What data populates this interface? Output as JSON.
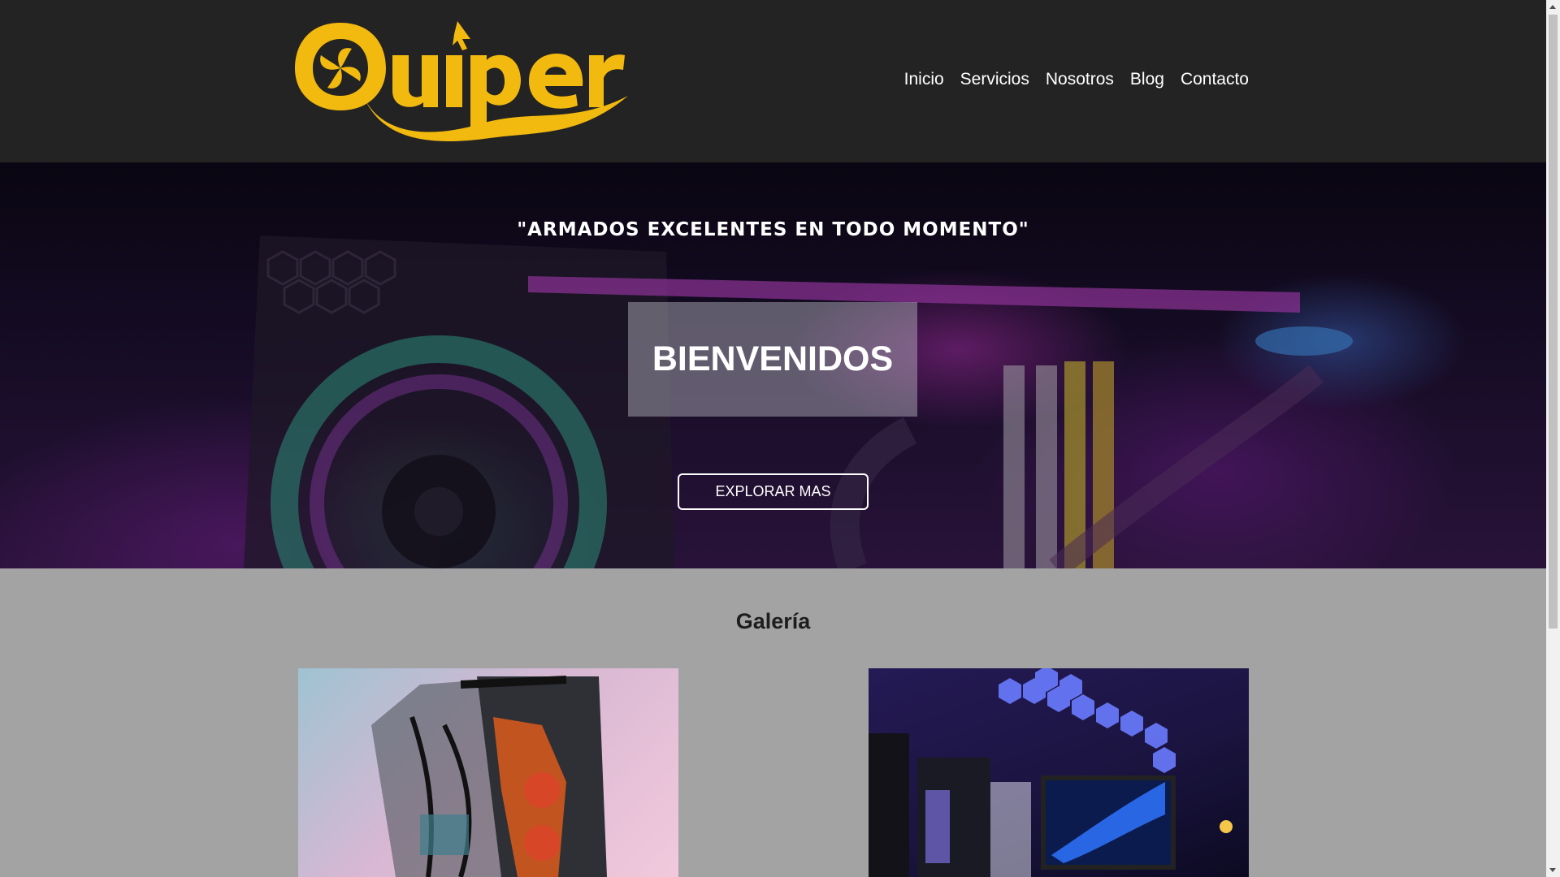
{
  "brand": {
    "name": "Quiper",
    "color": "#f2b90f"
  },
  "nav": {
    "items": [
      {
        "label": "Inicio"
      },
      {
        "label": "Servicios"
      },
      {
        "label": "Nosotros"
      },
      {
        "label": "Blog"
      },
      {
        "label": "Contacto"
      }
    ]
  },
  "hero": {
    "slogan": "\"ARMADOS EXCELENTES EN TODO MOMENTO\"",
    "welcome": "BIENVENIDOS",
    "cta_label": "EXPLORAR MAS"
  },
  "gallery": {
    "title": "Galería"
  },
  "colors": {
    "header_bg": "#232323",
    "section_bg": "#a3a3a3",
    "accent": "#f2b90f"
  }
}
